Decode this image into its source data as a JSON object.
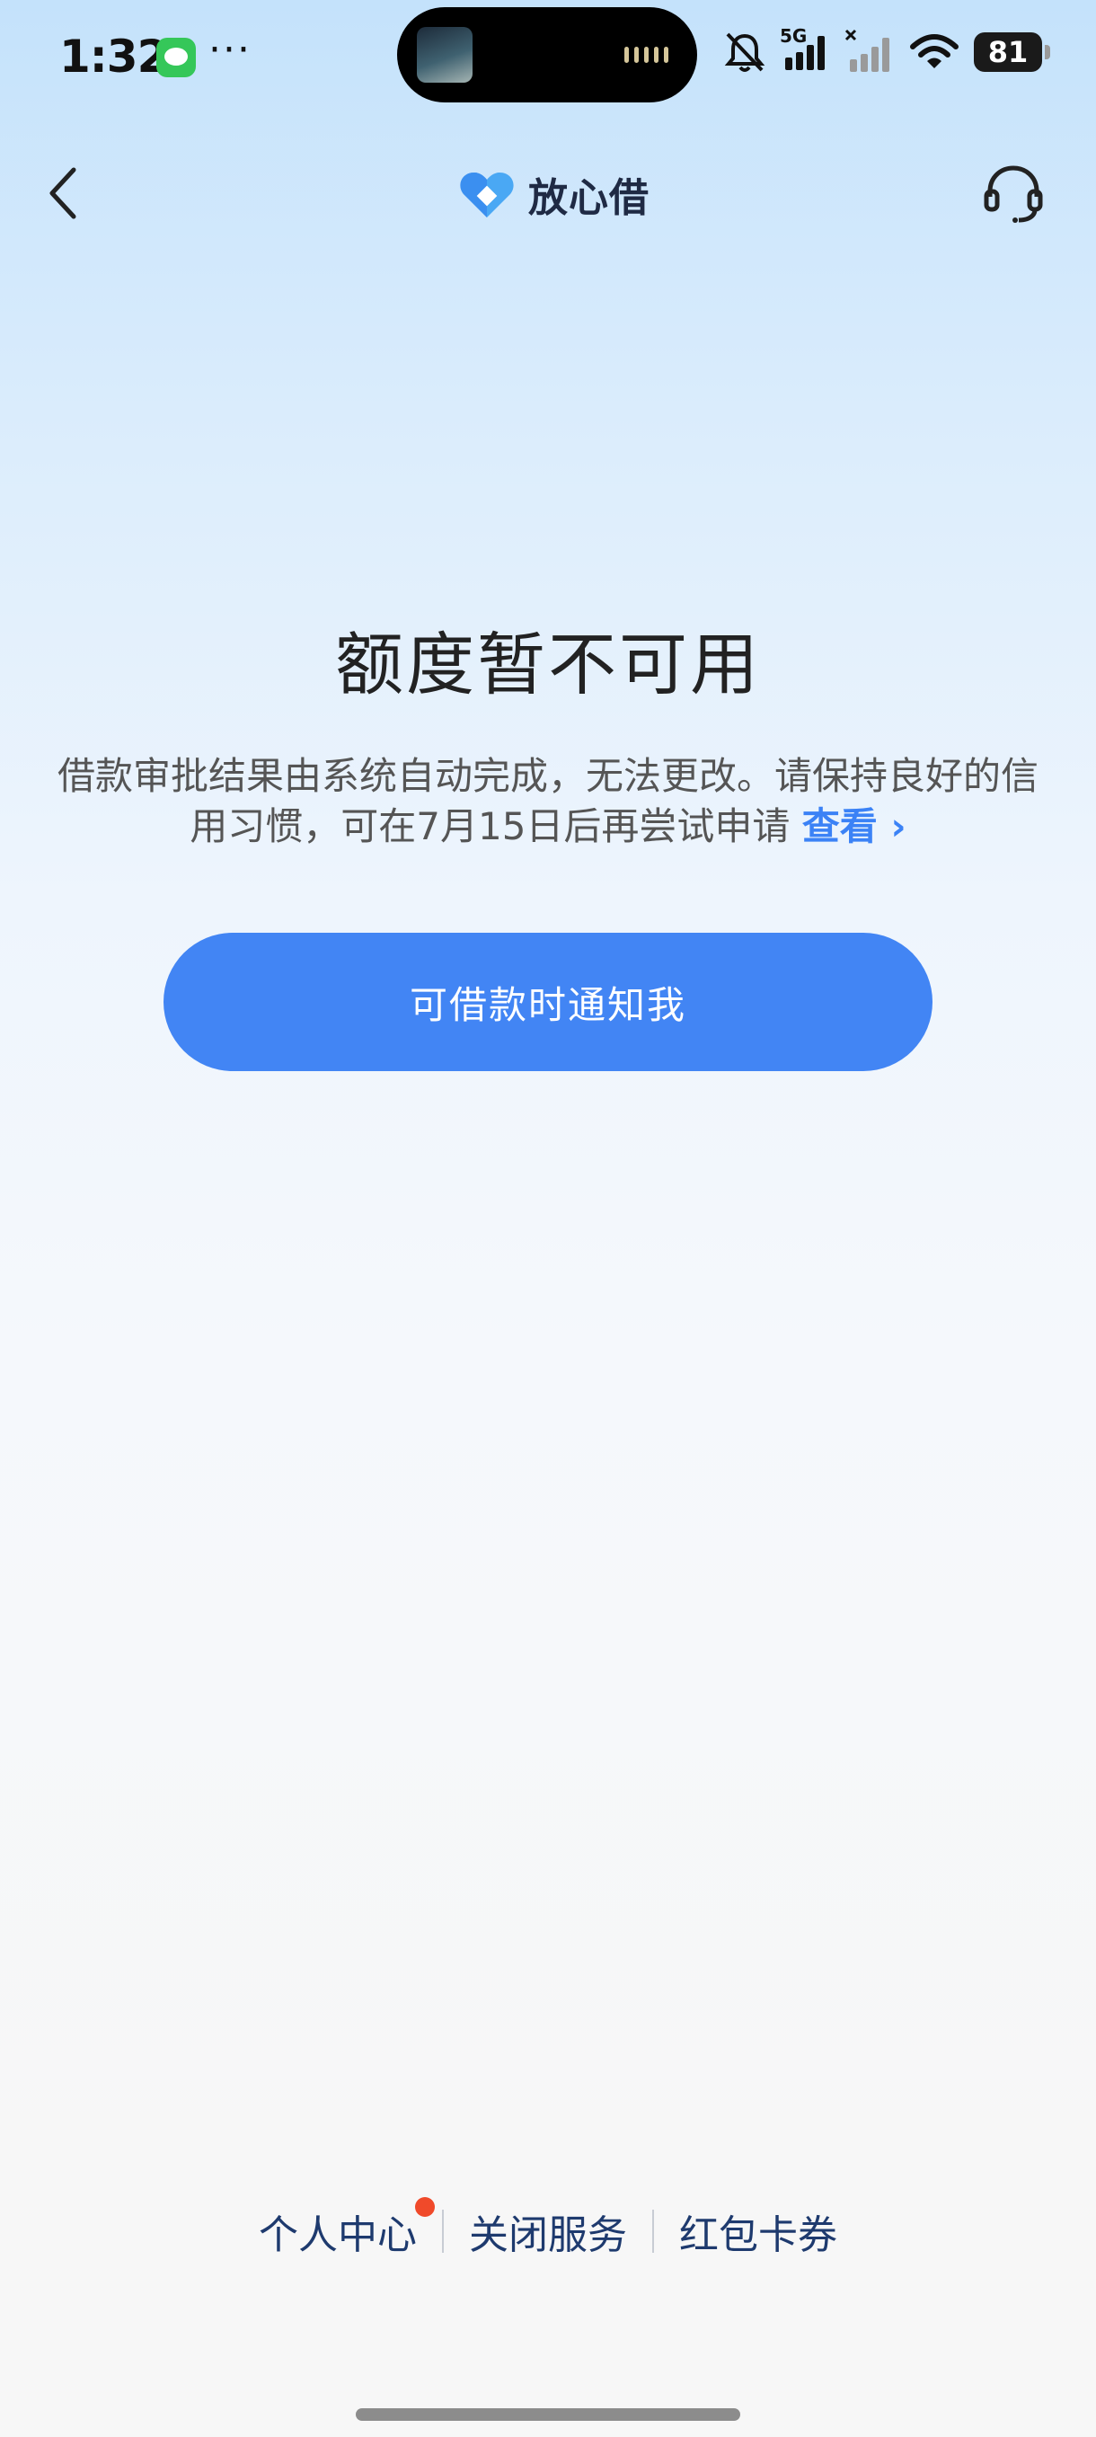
{
  "status_bar": {
    "time": "1:32",
    "dots": "···",
    "network_label": "5G",
    "battery": "81"
  },
  "nav": {
    "brand": "放心借"
  },
  "main": {
    "title": "额度暂不可用",
    "description": "借款审批结果由系统自动完成，无法更改。请保持良好的信用习惯，可在7月15日后再尝试申请",
    "view_link": "查看",
    "view_chevron": "›",
    "notify_button": "可借款时通知我"
  },
  "footer": {
    "personal_center": "个人中心",
    "close_service": "关闭服务",
    "coupons": "红包卡券"
  },
  "colors": {
    "accent": "#4285f4",
    "link": "#3b82f6",
    "badge": "#f04a2a",
    "footer_text": "#1e3a6e"
  },
  "icons": [
    "message-icon",
    "bell-muted-icon",
    "signal-icon",
    "wifi-icon",
    "battery-icon",
    "back-chevron-icon",
    "brand-logo-icon",
    "headset-icon"
  ]
}
